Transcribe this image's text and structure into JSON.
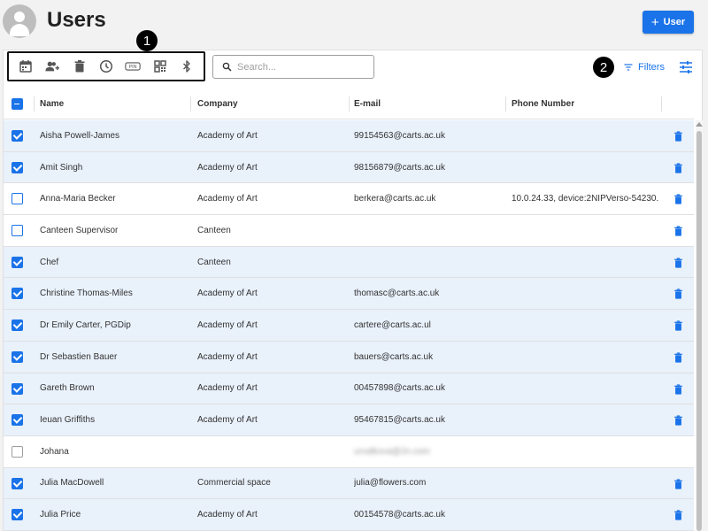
{
  "header": {
    "title": "Users",
    "add_button_label": "User",
    "add_button_icon": "+"
  },
  "toolbar": {
    "icons": [
      "calendar-icon",
      "add-person-icon",
      "trash-icon",
      "clock-icon",
      "pin-icon",
      "qr-code-icon",
      "bluetooth-icon"
    ],
    "pin_label": "PIN"
  },
  "markers": {
    "one": "1",
    "two": "2"
  },
  "search": {
    "placeholder": "Search..."
  },
  "filters": {
    "label": "Filters"
  },
  "table": {
    "columns": {
      "name": "Name",
      "company": "Company",
      "email": "E-mail",
      "phone": "Phone Number"
    },
    "rows": [
      {
        "name": "Aisha Powell-James",
        "company": "Academy of Art",
        "email": "99154563@carts.ac.uk",
        "phone": "",
        "checked": true
      },
      {
        "name": "Amit Singh",
        "company": "Academy of Art",
        "email": "98156879@carts.ac.uk",
        "phone": "",
        "checked": true
      },
      {
        "name": "Anna-Maria Becker",
        "company": "Academy of Art",
        "email": "berkera@carts.ac.uk",
        "phone": "10.0.24.33, device:2NIPVerso-54230...",
        "checked": false
      },
      {
        "name": "Canteen Supervisor",
        "company": "Canteen",
        "email": "",
        "phone": "",
        "checked": false
      },
      {
        "name": "Chef",
        "company": "Canteen",
        "email": "",
        "phone": "",
        "checked": true
      },
      {
        "name": "Christine Thomas-Miles",
        "company": "Academy of Art",
        "email": "thomasc@carts.ac.uk",
        "phone": "",
        "checked": true
      },
      {
        "name": "Dr Emily Carter, PGDip",
        "company": "Academy of Art",
        "email": "cartere@carts.ac.ul",
        "phone": "",
        "checked": true
      },
      {
        "name": "Dr Sebastien Bauer",
        "company": "Academy of Art",
        "email": "bauers@carts.ac.uk",
        "phone": "",
        "checked": true
      },
      {
        "name": "Gareth Brown",
        "company": "Academy of Art",
        "email": "00457898@carts.ac.uk",
        "phone": "",
        "checked": true
      },
      {
        "name": "Ieuan Griffiths",
        "company": "Academy of Art",
        "email": "95467815@carts.ac.uk",
        "phone": "",
        "checked": true
      },
      {
        "name": "Johana",
        "company": "",
        "email": "urvalkova@2n.com",
        "phone": "",
        "checked": false,
        "disabled": true
      },
      {
        "name": "Julia MacDowell",
        "company": "Commercial space",
        "email": "julia@flowers.com",
        "phone": "",
        "checked": true
      },
      {
        "name": "Julia Price",
        "company": "Academy of Art",
        "email": "00154578@carts.ac.uk",
        "phone": "",
        "checked": true
      }
    ]
  },
  "colors": {
    "accent": "#1a73e8",
    "selected_row": "#e9f1fb"
  }
}
